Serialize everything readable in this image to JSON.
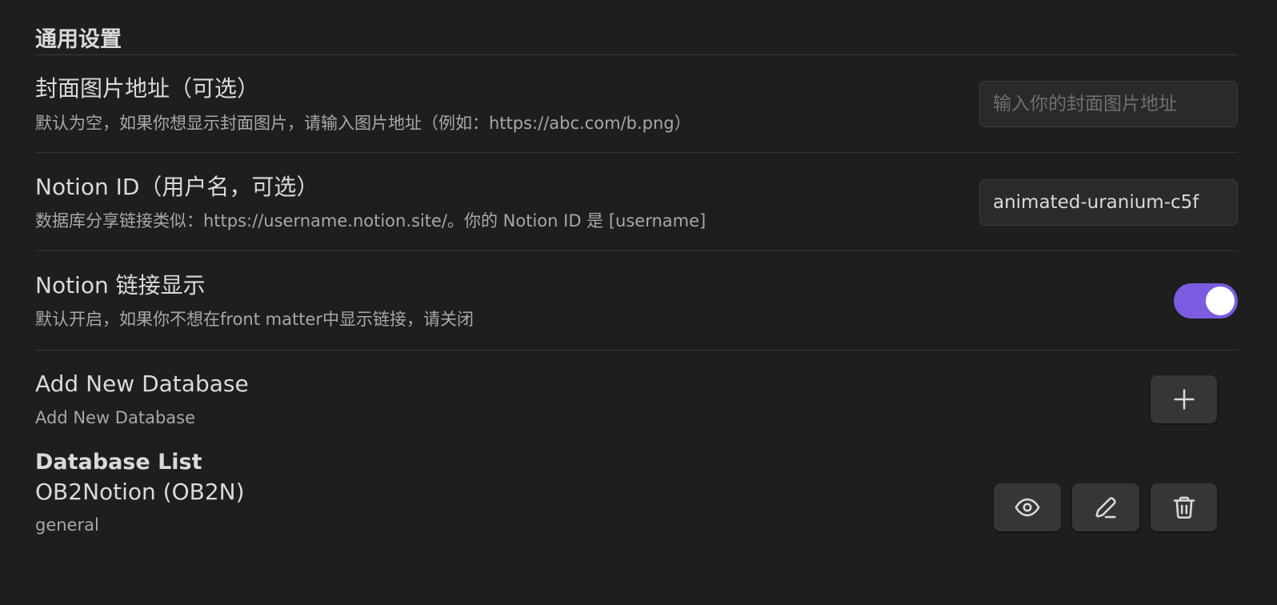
{
  "section": {
    "title": "通用设置"
  },
  "settings": [
    {
      "name": "封面图片地址（可选）",
      "description": "默认为空，如果你想显示封面图片，请输入图片地址（例如：https://abc.com/b.png）",
      "input_value": "",
      "input_placeholder": "输入你的封面图片地址"
    },
    {
      "name": "Notion ID（用户名，可选）",
      "description": "数据库分享链接类似：https://username.notion.site/。你的 Notion ID 是 [username]",
      "input_value": "animated-uranium-c5f",
      "input_placeholder": ""
    },
    {
      "name": "Notion 链接显示",
      "description": "默认开启，如果你不想在front matter中显示链接，请关闭",
      "toggle_on": true
    },
    {
      "name": "Add New Database",
      "description": "Add New Database",
      "button_icon": "plus-icon"
    }
  ],
  "database_list": {
    "title": "Database List",
    "items": [
      {
        "name": "OB2Notion (OB2N)",
        "tag": "general",
        "actions": [
          "eye-icon",
          "pencil-icon",
          "trash-icon"
        ]
      }
    ]
  },
  "colors": {
    "background": "#1e1e1e",
    "accent": "#7b5ce0",
    "text": "#dadada",
    "muted_text": "#a8a8a8"
  }
}
